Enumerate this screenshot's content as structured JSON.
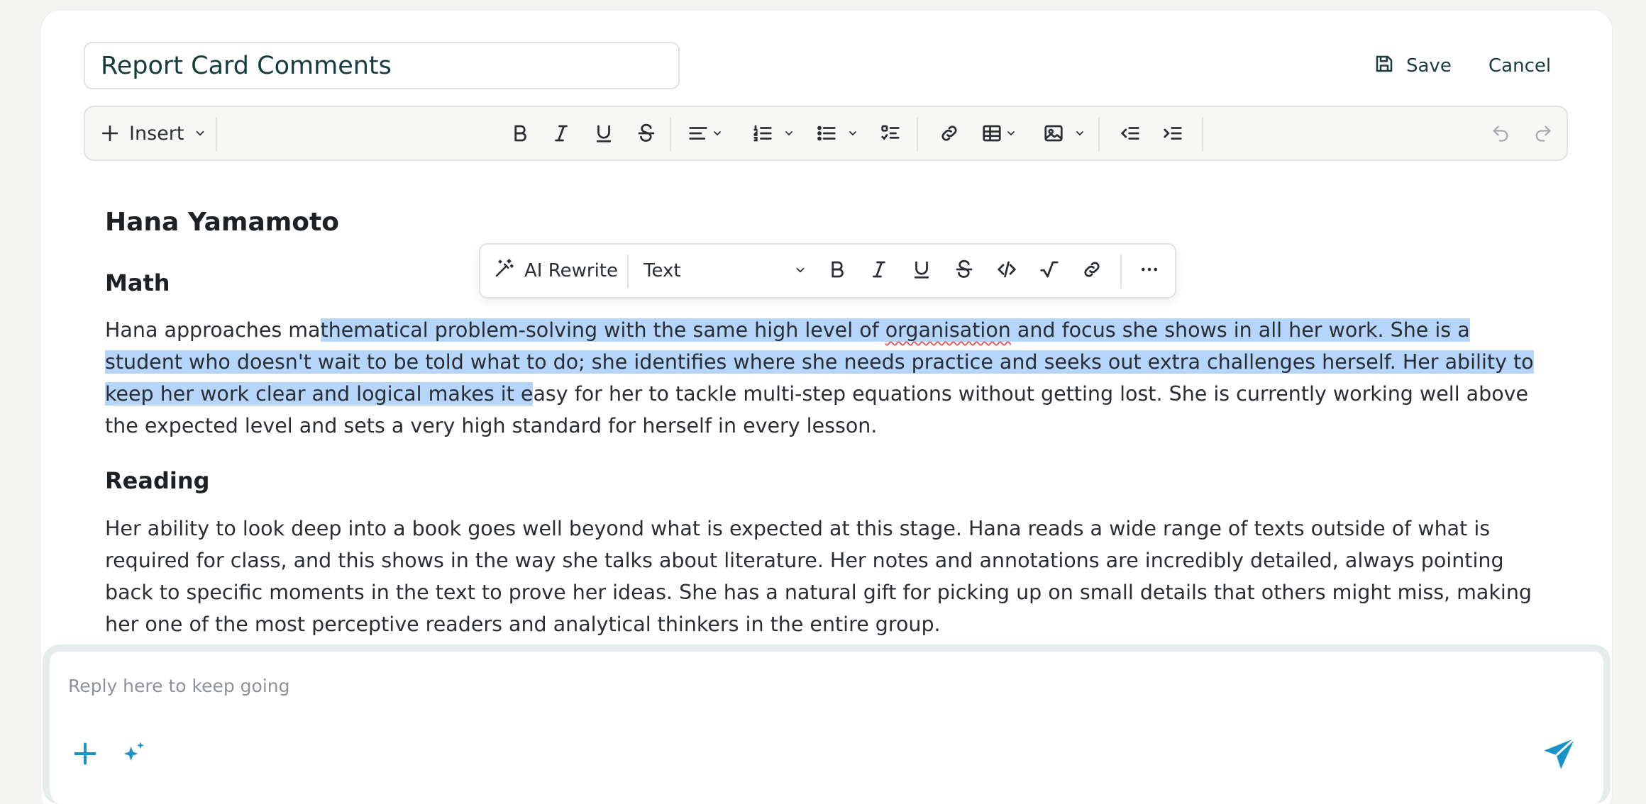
{
  "header": {
    "document_title": "Report Card Comments",
    "save_label": "Save",
    "cancel_label": "Cancel"
  },
  "toolbar": {
    "insert_label": "Insert"
  },
  "floating_toolbar": {
    "ai_rewrite_label": "AI Rewrite",
    "block_type_value": "Text"
  },
  "document": {
    "student_name": "Hana Yamamoto",
    "sections": [
      {
        "heading": "Math",
        "paragraph_parts": [
          "Hana approaches ma",
          "thematical problem-solving with the same high level of ",
          "organisation",
          " and focus she shows in all her work. She is a student who doesn't wait to be told what to do; she identifies where she needs practice and seeks out extra challenges herself. Her ability to keep her work clear and logical makes it e",
          "asy for her to tackle multi-step equations without getting lost. She is currently working well above the expected level and sets a very high standard for herself in every lesson."
        ]
      },
      {
        "heading": "Reading",
        "paragraph": "Her ability to look deep into a book goes well beyond what is expected at this stage. Hana reads a wide range of texts outside of what is required for class, and this shows in the way she talks about literature. Her notes and annotations are incredibly detailed, always pointing back to specific moments in the text to prove her ideas. She has a natural gift for picking up on small details that others might miss, making her one of the most perceptive readers and analytical thinkers in the entire group."
      }
    ]
  },
  "reply": {
    "placeholder": "Reply here to keep going"
  },
  "colors": {
    "selection": "#b6d5fb",
    "accent": "#1a93c8",
    "title_text": "#143c3a"
  }
}
